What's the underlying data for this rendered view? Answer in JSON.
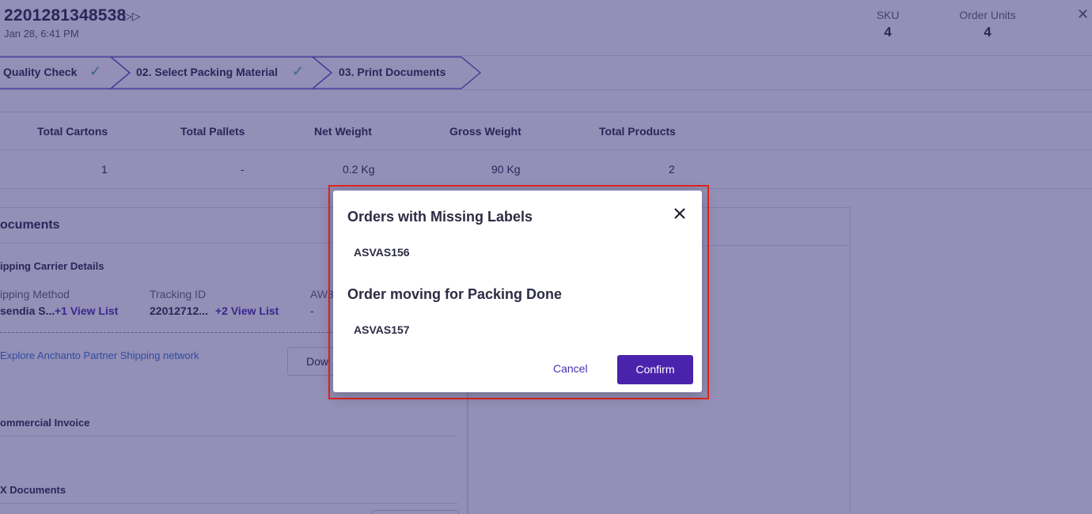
{
  "header": {
    "order_id": "2201281348538",
    "date": "Jan 28, 6:41 PM",
    "sku_label": "SKU",
    "sku_value": "4",
    "units_label": "Order Units",
    "units_value": "4"
  },
  "steps": [
    {
      "label": "Quality Check",
      "done": true
    },
    {
      "label": "02. Select Packing Material",
      "done": true
    },
    {
      "label": "03. Print Documents",
      "done": false
    }
  ],
  "summary": {
    "headers": [
      "Total Cartons",
      "Total Pallets",
      "Net Weight",
      "Gross Weight",
      "Total Products"
    ],
    "values": [
      "1",
      "-",
      "0.2 Kg",
      "90 Kg",
      "2"
    ]
  },
  "documents": {
    "title": "ocuments",
    "carrier_title": "ipping Carrier Details",
    "shipping_method_label": "ipping Method",
    "shipping_method_value": "sendia S...",
    "shipping_method_link": "+1 View List",
    "tracking_label": "Tracking ID",
    "tracking_value": "22012712...",
    "tracking_link": "+2 View List",
    "awb_label": "AW3",
    "awb_value": "-",
    "explore_link": "Explore Anchanto Partner Shipping network",
    "download_button": "Dow",
    "invoice_title": "ommercial Invoice",
    "x_documents_title": "X Documents"
  },
  "modal": {
    "title": "Orders with Missing Labels",
    "missing_orders": [
      "ASVAS156"
    ],
    "title2": "Order moving for Packing Done",
    "moving_orders": [
      "ASVAS157"
    ],
    "cancel_label": "Cancel",
    "confirm_label": "Confirm"
  },
  "colors": {
    "accent": "#4a23ad",
    "overlay": "#28206e",
    "highlight": "#e0251b",
    "check": "#4bb38a",
    "link": "#3c7ad6"
  }
}
